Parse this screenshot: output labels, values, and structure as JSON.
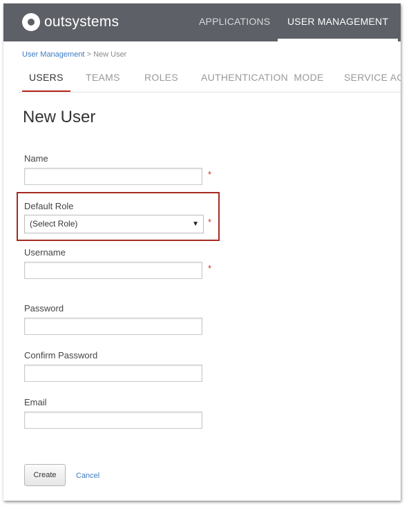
{
  "brand": {
    "logo_text": "outsystems",
    "topbar_color": "#5d6066",
    "accent_color": "#b7261a",
    "link_color": "#3b7ac2"
  },
  "topnav": {
    "items": [
      {
        "label": "APPLICATIONS",
        "active": false
      },
      {
        "label": "USER MANAGEMENT",
        "active": true
      }
    ]
  },
  "breadcrumb": {
    "parent": "User Management",
    "separator": ">",
    "current": "New User"
  },
  "tabs": [
    {
      "label": "USERS",
      "active": true
    },
    {
      "label": "TEAMS",
      "active": false
    },
    {
      "label": "ROLES",
      "active": false
    },
    {
      "label": "AUTHENTICATION  MODE",
      "active": false
    },
    {
      "label": "SERVICE ACC",
      "active": false
    }
  ],
  "page": {
    "title": "New User"
  },
  "form": {
    "required_marker": "*",
    "name": {
      "label": "Name",
      "value": ""
    },
    "default_role": {
      "label": "Default Role",
      "selected": "(Select Role)"
    },
    "username": {
      "label": "Username",
      "value": ""
    },
    "password": {
      "label": "Password",
      "value": ""
    },
    "confirm_password": {
      "label": "Confirm Password",
      "value": ""
    },
    "email": {
      "label": "Email",
      "value": ""
    }
  },
  "actions": {
    "create_label": "Create",
    "cancel_label": "Cancel"
  }
}
